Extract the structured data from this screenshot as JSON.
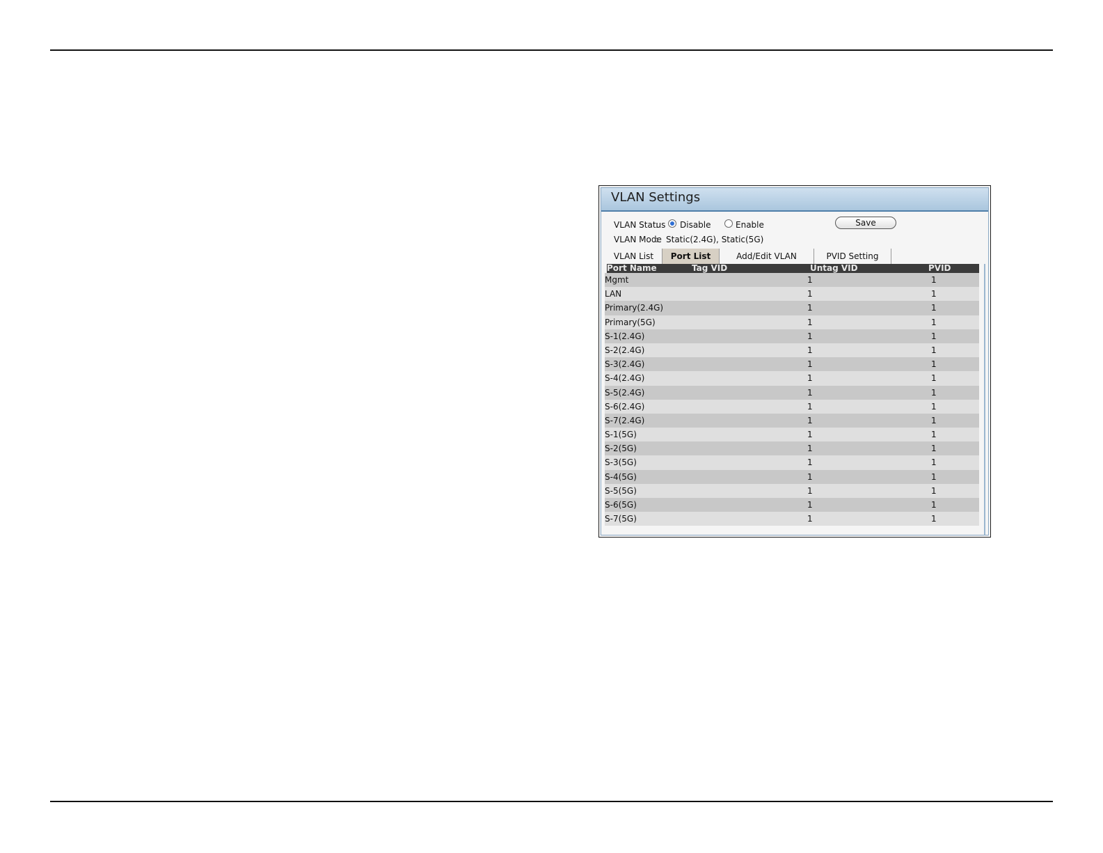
{
  "panel": {
    "title": "VLAN Settings",
    "status_label": "VLAN Status",
    "status_sep": ":",
    "status_options": [
      {
        "label": "Disable",
        "checked": true
      },
      {
        "label": "Enable",
        "checked": false
      }
    ],
    "save_label": "Save",
    "mode_label": "VLAN Mode",
    "mode_sep": ":",
    "mode_value": "Static(2.4G),  Static(5G)"
  },
  "tabs": [
    {
      "label": "VLAN List",
      "active": false
    },
    {
      "label": "Port List",
      "active": true
    },
    {
      "label": "Add/Edit VLAN",
      "active": false
    },
    {
      "label": "PVID Setting",
      "active": false
    }
  ],
  "table": {
    "headers": [
      "Port Name",
      "Tag VID",
      "Untag VID",
      "PVID"
    ],
    "rows": [
      {
        "name": "Mgmt",
        "tag": "",
        "untag": "1",
        "pvid": "1"
      },
      {
        "name": "LAN",
        "tag": "",
        "untag": "1",
        "pvid": "1"
      },
      {
        "name": "Primary(2.4G)",
        "tag": "",
        "untag": "1",
        "pvid": "1"
      },
      {
        "name": "Primary(5G)",
        "tag": "",
        "untag": "1",
        "pvid": "1"
      },
      {
        "name": "S-1(2.4G)",
        "tag": "",
        "untag": "1",
        "pvid": "1"
      },
      {
        "name": "S-2(2.4G)",
        "tag": "",
        "untag": "1",
        "pvid": "1"
      },
      {
        "name": "S-3(2.4G)",
        "tag": "",
        "untag": "1",
        "pvid": "1"
      },
      {
        "name": "S-4(2.4G)",
        "tag": "",
        "untag": "1",
        "pvid": "1"
      },
      {
        "name": "S-5(2.4G)",
        "tag": "",
        "untag": "1",
        "pvid": "1"
      },
      {
        "name": "S-6(2.4G)",
        "tag": "",
        "untag": "1",
        "pvid": "1"
      },
      {
        "name": "S-7(2.4G)",
        "tag": "",
        "untag": "1",
        "pvid": "1"
      },
      {
        "name": "S-1(5G)",
        "tag": "",
        "untag": "1",
        "pvid": "1"
      },
      {
        "name": "S-2(5G)",
        "tag": "",
        "untag": "1",
        "pvid": "1"
      },
      {
        "name": "S-3(5G)",
        "tag": "",
        "untag": "1",
        "pvid": "1"
      },
      {
        "name": "S-4(5G)",
        "tag": "",
        "untag": "1",
        "pvid": "1"
      },
      {
        "name": "S-5(5G)",
        "tag": "",
        "untag": "1",
        "pvid": "1"
      },
      {
        "name": "S-6(5G)",
        "tag": "",
        "untag": "1",
        "pvid": "1"
      },
      {
        "name": "S-7(5G)",
        "tag": "",
        "untag": "1",
        "pvid": "1"
      }
    ]
  },
  "colors": {
    "title_bar": "#aac6de",
    "active_tab": "#d7d0c4",
    "header_bg": "#3b3b3b",
    "radio_selected": "#2f6fd3"
  }
}
